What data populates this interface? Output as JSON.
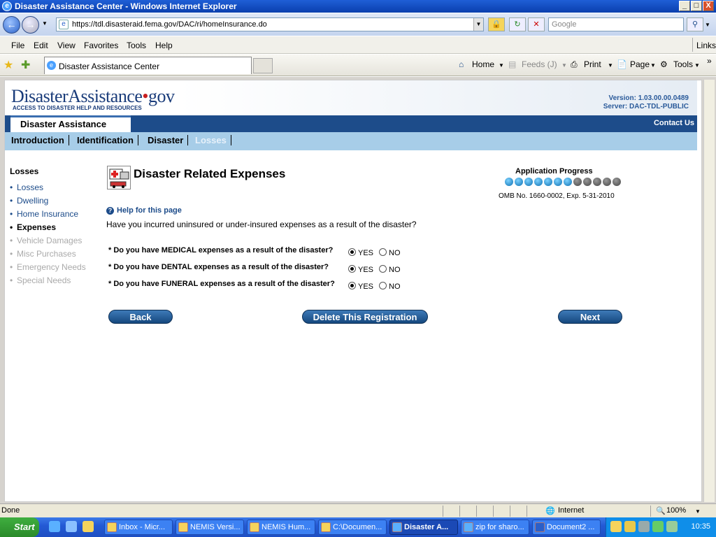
{
  "window": {
    "title": "Disaster Assistance Center - Windows Internet Explorer",
    "url": "https://tdl.disasteraid.fema.gov/DAC/ri/homeInsurance.do",
    "search_placeholder": "Google",
    "controls": {
      "minimize": "_",
      "maximize": "□",
      "close": "X"
    }
  },
  "menu": [
    "File",
    "Edit",
    "View",
    "Favorites",
    "Tools",
    "Help"
  ],
  "menu_links": "Links",
  "tab": {
    "title": "Disaster Assistance Center"
  },
  "commandbar": {
    "home": "Home",
    "feeds": "Feeds (J)",
    "print": "Print",
    "page": "Page",
    "tools": "Tools"
  },
  "site": {
    "logo_main": "DisasterAssistance",
    "logo_dot": "•",
    "logo_gov": "gov",
    "tagline": "ACCESS TO DISASTER HELP AND RESOURCES",
    "version": "Version: 1.03.00.00.0489",
    "server": "Server: DAC-TDL-PUBLIC",
    "section_tab": "Disaster Assistance",
    "contact": "Contact Us",
    "nav": [
      "Introduction",
      "Identification",
      "Disaster",
      "Losses"
    ]
  },
  "sidebar": {
    "heading": "Losses",
    "items": [
      {
        "label": "Losses",
        "state": "link"
      },
      {
        "label": "Dwelling",
        "state": "link"
      },
      {
        "label": "Home Insurance",
        "state": "link"
      },
      {
        "label": "Expenses",
        "state": "current"
      },
      {
        "label": "Vehicle Damages",
        "state": "disabled"
      },
      {
        "label": "Misc Purchases",
        "state": "disabled"
      },
      {
        "label": "Emergency Needs",
        "state": "disabled"
      },
      {
        "label": "Special Needs",
        "state": "disabled"
      }
    ]
  },
  "main": {
    "title": "Disaster Related Expenses",
    "progress_label": "Application Progress",
    "progress_completed": 7,
    "progress_total": 12,
    "omb": "OMB No. 1660-0002, Exp. 5-31-2010",
    "help": "Help for this page",
    "intro": "Have you incurred uninsured or under-insured expenses as a result of the disaster?",
    "questions": [
      {
        "label": "* Do you have MEDICAL expenses as a result of the disaster?",
        "selected": "YES"
      },
      {
        "label": "* Do you have DENTAL expenses as a result of the disaster?",
        "selected": "YES"
      },
      {
        "label": "* Do you have FUNERAL expenses as a result of the disaster?",
        "selected": "YES"
      }
    ],
    "yes": "YES",
    "no": "NO",
    "buttons": {
      "back": "Back",
      "delete": "Delete This Registration",
      "next": "Next"
    }
  },
  "status": {
    "text": "Done",
    "zone": "Internet",
    "zoom": "100%"
  },
  "taskbar": {
    "start": "Start",
    "items": [
      "Inbox - Micr...",
      "NEMIS Versi...",
      "NEMIS Hum...",
      "C:\\Documen...",
      "Disaster A...",
      "zip for sharo...",
      "Document2 ..."
    ],
    "active_index": 4,
    "clock": "10:35"
  }
}
